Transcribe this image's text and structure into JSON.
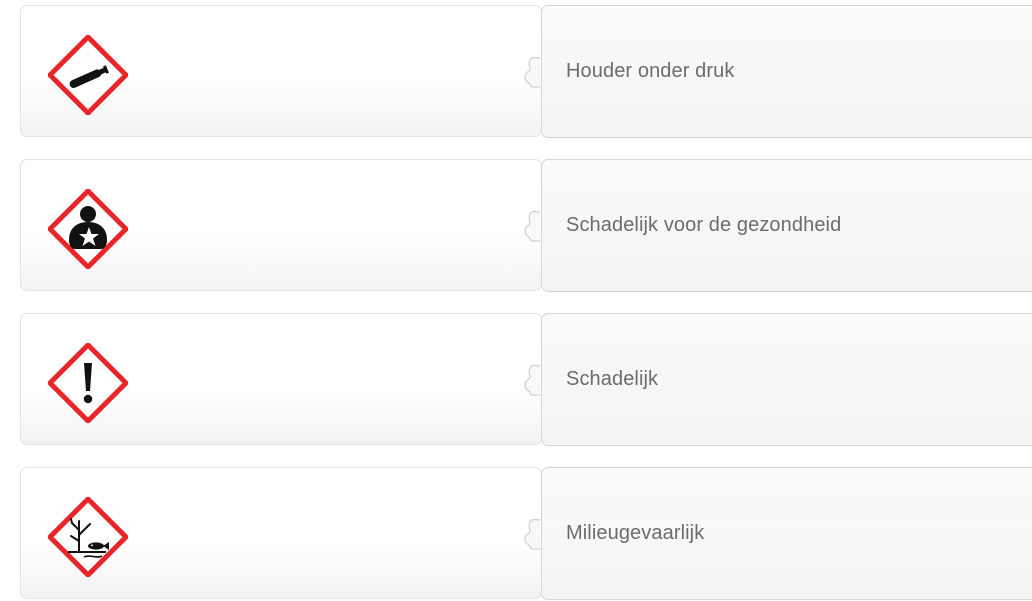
{
  "pairs": [
    {
      "icon": "gas-cylinder-icon",
      "label": "Houder onder druk"
    },
    {
      "icon": "health-hazard-icon",
      "label": "Schadelijk voor de gezondheid"
    },
    {
      "icon": "exclamation-mark-icon",
      "label": "Schadelijk"
    },
    {
      "icon": "environment-hazard-icon",
      "label": "Milieugevaarlijk"
    }
  ],
  "colors": {
    "pictogram_border": "#e8262a",
    "pictogram_symbol": "#111111",
    "label_text": "#6c6c6c",
    "card_border": "#d6d6d6"
  }
}
